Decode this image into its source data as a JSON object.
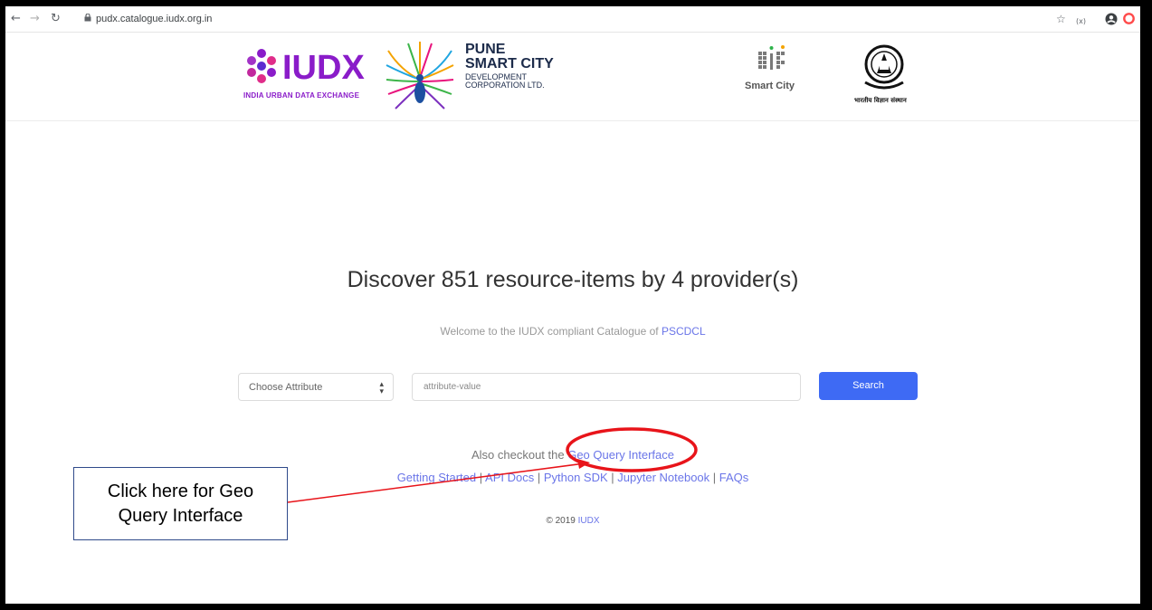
{
  "browser": {
    "url": "pudx.catalogue.iudx.org.in",
    "indicator": "(x)"
  },
  "header": {
    "iudx_logo": "IUDX",
    "iudx_tagline": "INDIA URBAN DATA EXCHANGE",
    "pune_line1": "PUNE",
    "pune_line2": "SMART CITY",
    "pune_line3": "DEVELOPMENT",
    "pune_line4": "CORPORATION LTD.",
    "smart_city": "Smart City",
    "iisc_caption": "भारतीय विज्ञान संस्थान"
  },
  "main": {
    "title": "Discover 851 resource-items by 4 provider(s)",
    "welcome_prefix": "Welcome to the IUDX compliant Catalogue of ",
    "welcome_link": "PSCDCL",
    "select_label": "Choose Attribute",
    "input_placeholder": "attribute-value",
    "search_label": "Search",
    "also_prefix": "Also checkout the ",
    "geo_link": "Geo Query Interface",
    "links": [
      "Getting Started",
      "API Docs",
      "Python SDK",
      "Jupyter Notebook",
      "FAQs"
    ],
    "copyright_prefix": "© 2019 ",
    "copyright_link": "IUDX"
  },
  "annotation": {
    "text_line1": "Click here for Geo",
    "text_line2": "Query Interface",
    "highlight_color": "#e8141a"
  },
  "colors": {
    "accent": "#3e6af4",
    "link": "#6a75e8",
    "iudx_purple": "#8a1cc9"
  }
}
